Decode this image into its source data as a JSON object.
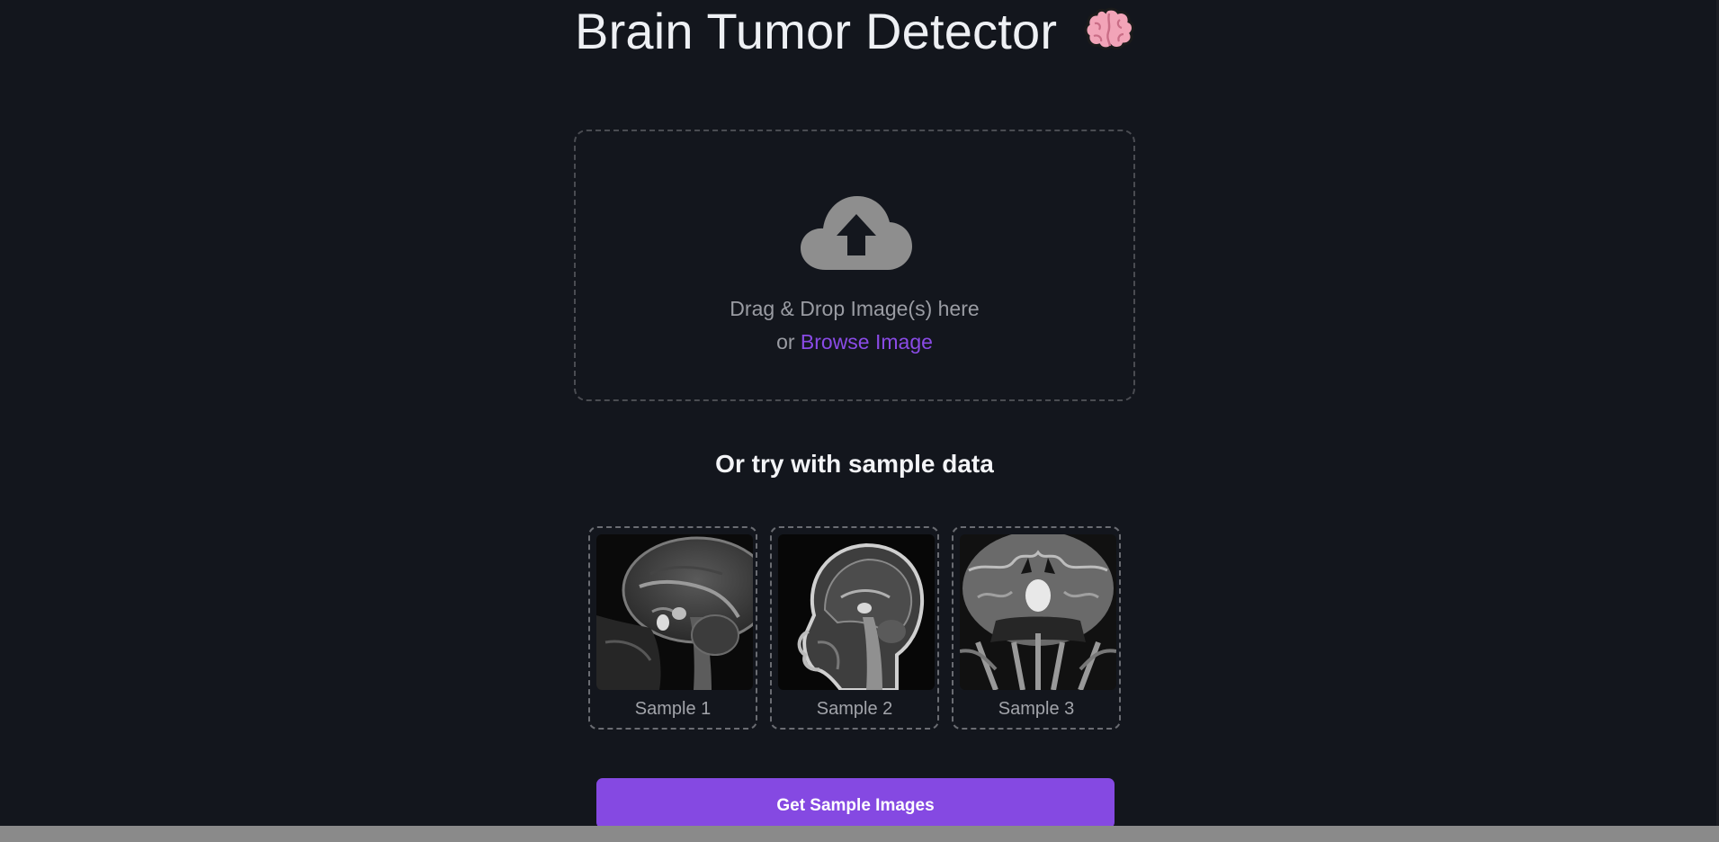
{
  "header": {
    "title": "Brain Tumor Detector",
    "emoji": "🧠"
  },
  "upload": {
    "icon": "cloud-upload-icon",
    "drag_text": "Drag & Drop Image(s) here",
    "or_text": "or",
    "browse_label": "Browse Image"
  },
  "samples": {
    "heading": "Or try with sample data",
    "items": [
      {
        "label": "Sample 1"
      },
      {
        "label": "Sample 2"
      },
      {
        "label": "Sample 3"
      }
    ]
  },
  "actions": {
    "get_samples_label": "Get Sample Images"
  },
  "colors": {
    "background": "#13161d",
    "accent": "#8549e2",
    "link": "#8a4be6",
    "muted_text": "#9a9ca3"
  }
}
